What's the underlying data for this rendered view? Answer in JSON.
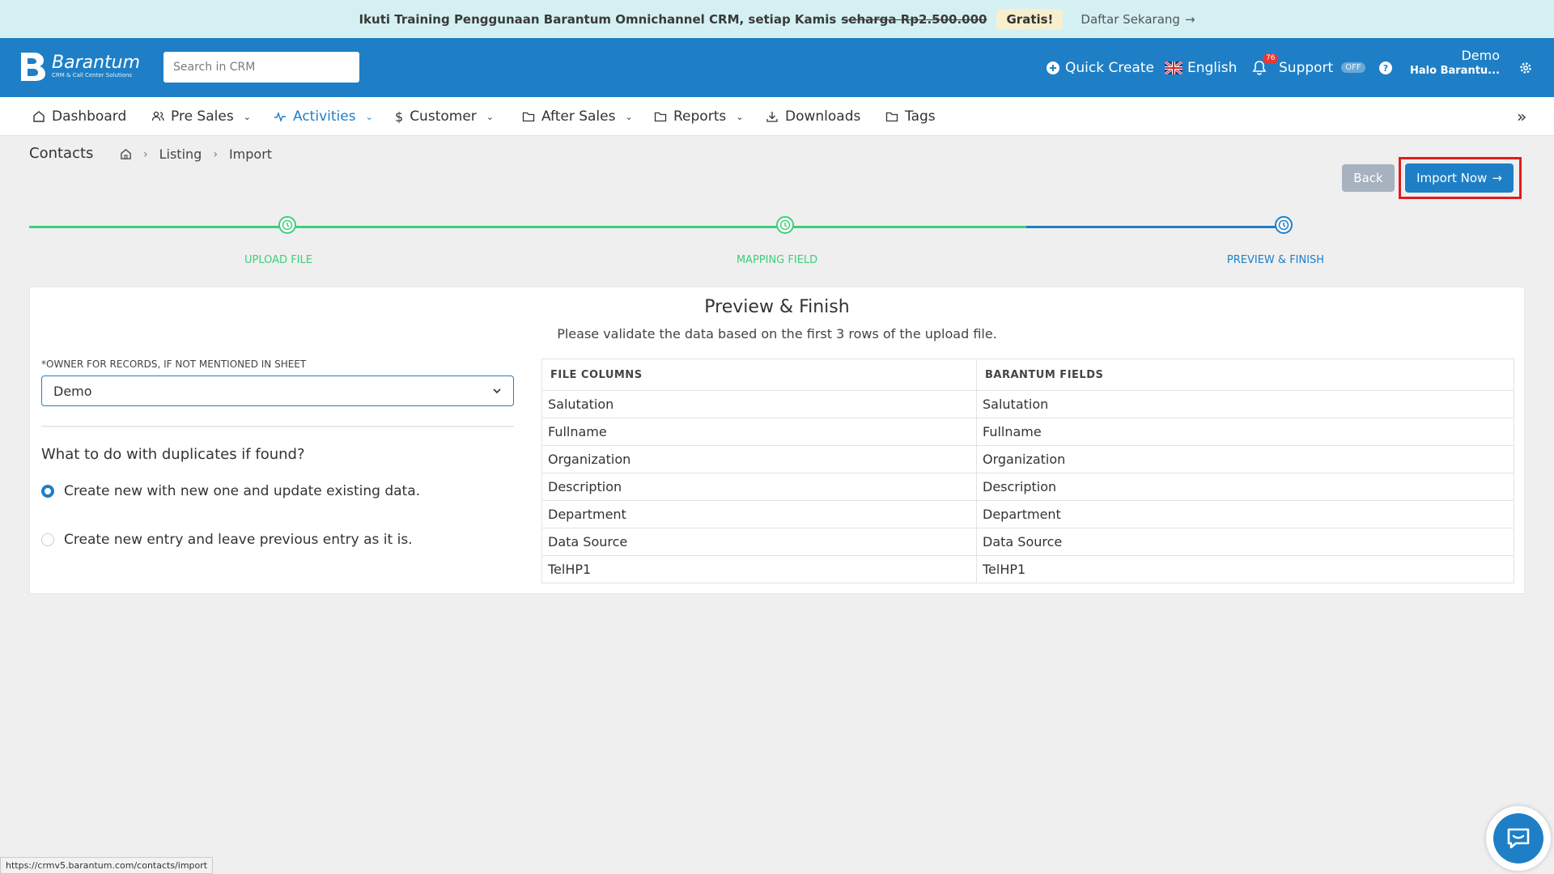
{
  "promo": {
    "text": "Ikuti Training Penggunaan Barantum Omnichannel CRM, setiap Kamis",
    "old_price": "seharga Rp2.500.000",
    "badge": "Gratis!",
    "link": "Daftar Sekarang"
  },
  "header": {
    "logo_name": "Barantum",
    "logo_sub": "CRM & Call Center Solutions",
    "search_placeholder": "Search in CRM",
    "quick_create": "Quick Create",
    "language": "English",
    "notif_count": "76",
    "support": "Support",
    "support_state": "OFF",
    "user_name": "Demo",
    "user_greeting": "Halo Barantu..."
  },
  "nav": {
    "items": [
      {
        "label": "Dashboard"
      },
      {
        "label": "Pre Sales"
      },
      {
        "label": "Activities"
      },
      {
        "label": "Customer"
      },
      {
        "label": "After Sales"
      },
      {
        "label": "Reports"
      },
      {
        "label": "Downloads"
      },
      {
        "label": "Tags"
      }
    ]
  },
  "breadcrumb": {
    "title": "Contacts",
    "items": [
      "Listing",
      "Import"
    ]
  },
  "actions": {
    "back": "Back",
    "import_now": "Import Now"
  },
  "stepper": {
    "steps": [
      "UPLOAD FILE",
      "MAPPING FIELD",
      "PREVIEW & FINISH"
    ],
    "colors": {
      "done": "#3ecf7a",
      "current": "#1e7fc6"
    }
  },
  "preview": {
    "title": "Preview & Finish",
    "subtitle": "Please validate the data based on the first 3 rows of the upload file.",
    "owner_label": "*OWNER FOR RECORDS, IF NOT MENTIONED IN SHEET",
    "owner_value": "Demo",
    "duplicates_question": "What to do with duplicates if found?",
    "option_1": "Create new with new one and update existing data.",
    "option_2": "Create new entry and leave previous entry as it is.",
    "selected_option": 1
  },
  "mapping": {
    "headers": [
      "FILE COLUMNS",
      "BARANTUM FIELDS"
    ],
    "rows": [
      [
        "Salutation",
        "Salutation"
      ],
      [
        "Fullname",
        "Fullname"
      ],
      [
        "Organization",
        "Organization"
      ],
      [
        "Description",
        "Description"
      ],
      [
        "Department",
        "Department"
      ],
      [
        "Data Source",
        "Data Source"
      ],
      [
        "TelHP1",
        "TelHP1"
      ]
    ]
  },
  "status_url": "https://crmv5.barantum.com/contacts/import"
}
